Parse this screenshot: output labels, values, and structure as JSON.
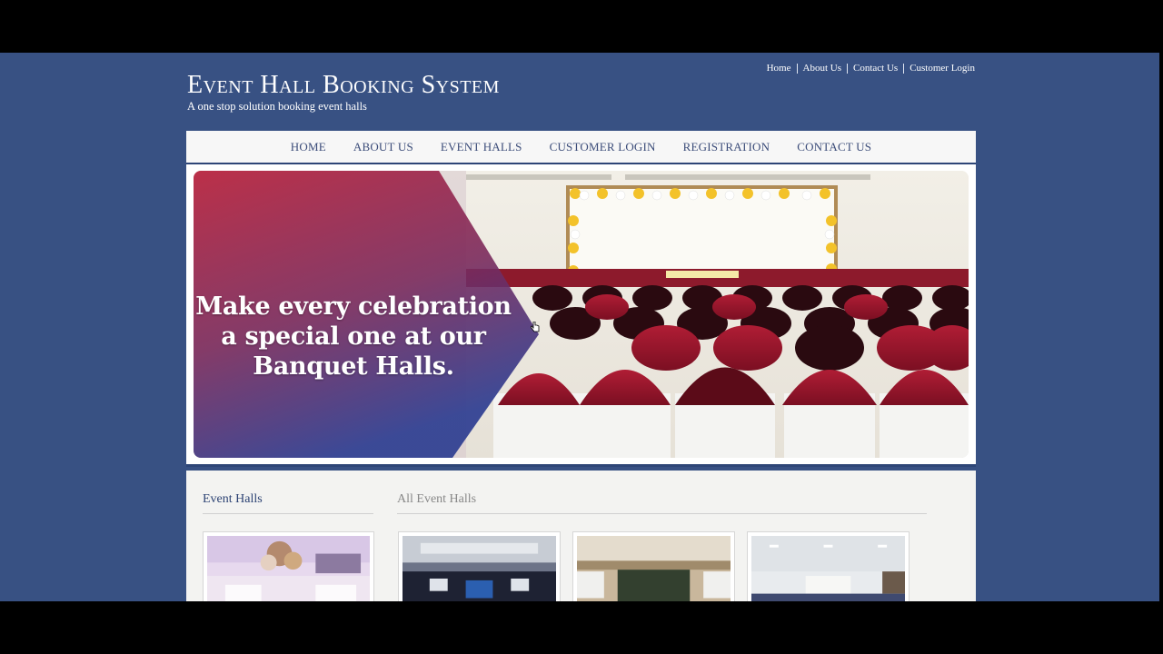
{
  "top_links": [
    "Home",
    "About Us",
    "Contact Us",
    "Customer Login"
  ],
  "brand": {
    "title": "Event Hall Booking System",
    "tagline": "A one stop solution booking event halls"
  },
  "nav": [
    "HOME",
    "ABOUT US",
    "EVENT HALLS",
    "CUSTOMER LOGIN",
    "REGISTRATION",
    "CONTACT US"
  ],
  "banner": {
    "line1": "Make every celebration",
    "line2": "a special one at our",
    "line3": "Banquet Halls."
  },
  "sections": {
    "sidebar_title": "Event Halls",
    "main_title": "All Event Halls"
  },
  "colors": {
    "page_bg": "#385183",
    "nav_text": "#3b4c79",
    "accent_dark": "#2e4677",
    "banner_overlay_top": "#a8203f",
    "banner_overlay_bottom": "#3a3a8a"
  },
  "icons": [
    "pointer-cursor-icon"
  ]
}
